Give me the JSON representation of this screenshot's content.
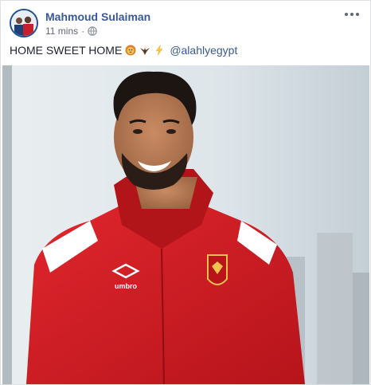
{
  "post": {
    "author": "Mahmoud Sulaiman",
    "timestamp": "11 mins",
    "separator": "·",
    "privacy_icon": "globe-icon",
    "more_icon": "more-options-icon",
    "text": "HOME SWEET HOME",
    "emojis": [
      "lion-emoji",
      "eagle-emoji",
      "lightning-emoji"
    ],
    "mention": "@alahlyegypt",
    "photo": {
      "jersey_brand": "umbro",
      "jersey_color": "#d91f26",
      "background_color": "#cfd9e0"
    }
  },
  "colors": {
    "link": "#385898",
    "text": "#1d2129",
    "meta": "#616770",
    "border": "#dddfe2"
  }
}
